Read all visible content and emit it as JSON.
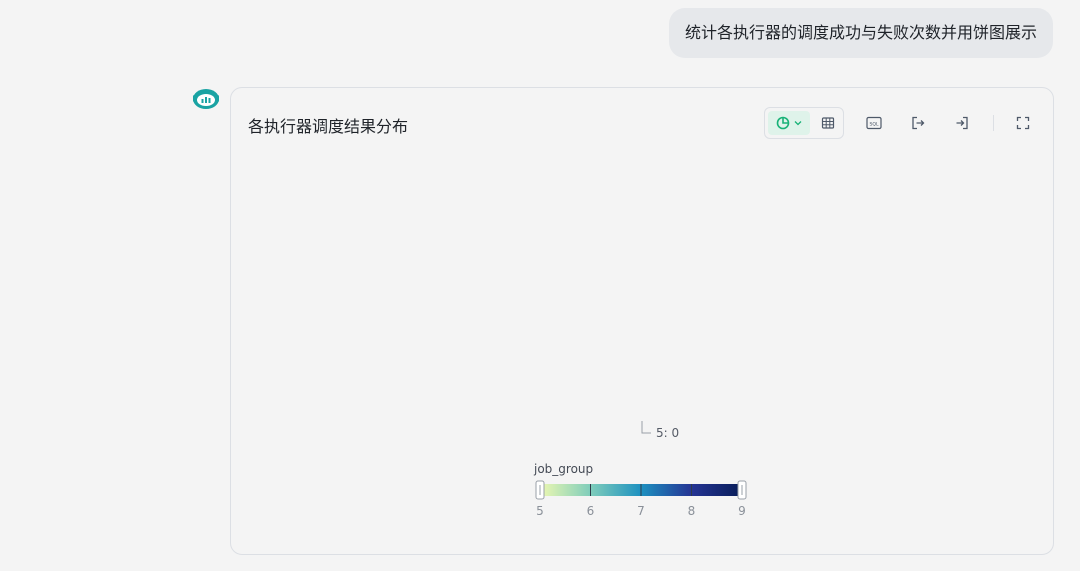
{
  "user_message": "统计各执行器的调度成功与失败次数并用饼图展示",
  "card": {
    "title": "各执行器调度结果分布"
  },
  "toolbar": {
    "chart_icon": "pie-chart-icon",
    "dropdown_icon": "chevron-down-icon",
    "table_icon": "table-icon",
    "sql_icon": "sql-icon",
    "sql_label": "SQL",
    "export_icon": "export-icon",
    "import_icon": "insert-icon",
    "fullscreen_icon": "fullscreen-icon",
    "accent": "#18b277"
  },
  "chart_data": {
    "type": "pie",
    "slices": [
      {
        "label": "5: 0",
        "value": 0
      }
    ],
    "visual_map": {
      "title": "job_group",
      "range": [
        5,
        9
      ],
      "ticks": [
        "5",
        "6",
        "7",
        "8",
        "9"
      ],
      "colors": [
        "#edf8b1",
        "#7fcdbb",
        "#1d91c0",
        "#253494",
        "#081d58"
      ]
    }
  }
}
